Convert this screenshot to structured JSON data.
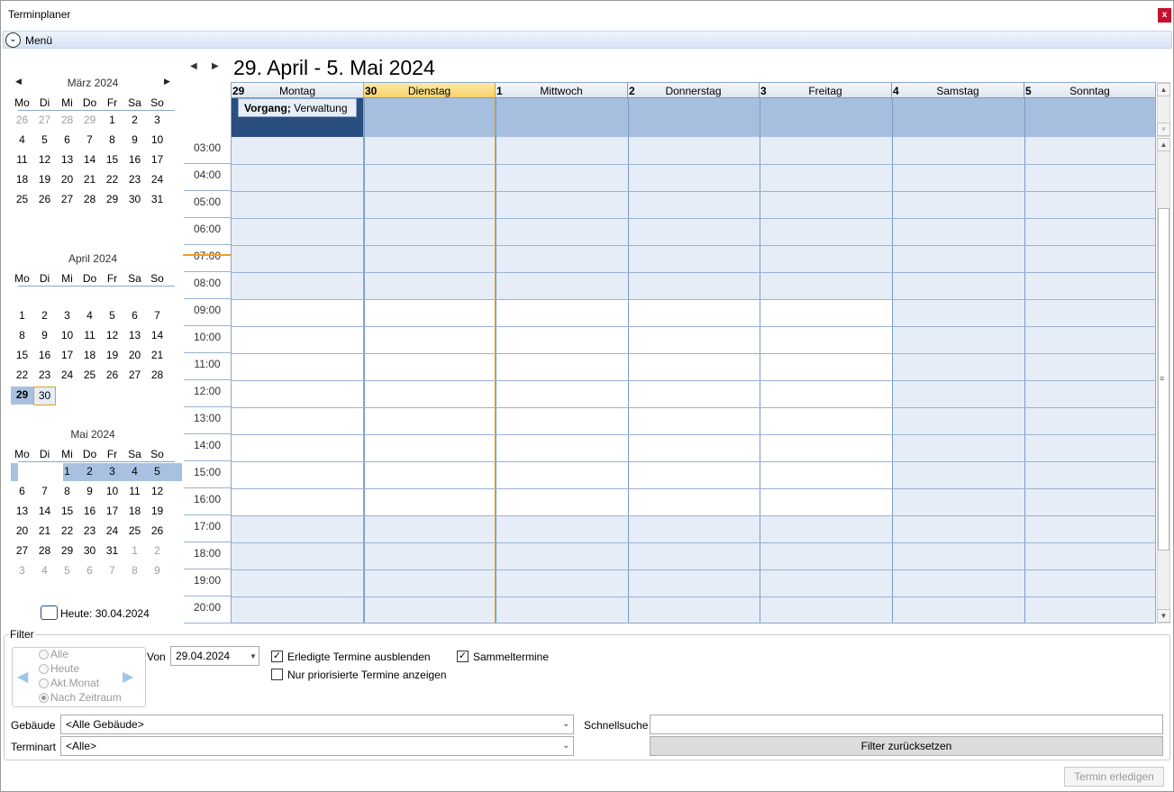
{
  "window": {
    "title": "Terminplaner",
    "close_label": "x"
  },
  "menu": {
    "label": "Menü",
    "icon": "chevron-down-icon"
  },
  "weekday_short": [
    "Mo",
    "Di",
    "Mi",
    "Do",
    "Fr",
    "Sa",
    "So"
  ],
  "mini_calendars": [
    {
      "title": "März 2024",
      "weeks": [
        [
          "26",
          "27",
          "28",
          "29",
          "1",
          "2",
          "3"
        ],
        [
          "4",
          "5",
          "6",
          "7",
          "8",
          "9",
          "10"
        ],
        [
          "11",
          "12",
          "13",
          "14",
          "15",
          "16",
          "17"
        ],
        [
          "18",
          "19",
          "20",
          "21",
          "22",
          "23",
          "24"
        ],
        [
          "25",
          "26",
          "27",
          "28",
          "29",
          "30",
          "31"
        ]
      ]
    },
    {
      "title": "April 2024",
      "weeks": [
        [
          "",
          "",
          "",
          "",
          "",
          "",
          ""
        ],
        [
          "1",
          "2",
          "3",
          "4",
          "5",
          "6",
          "7"
        ],
        [
          "8",
          "9",
          "10",
          "11",
          "12",
          "13",
          "14"
        ],
        [
          "15",
          "16",
          "17",
          "18",
          "19",
          "20",
          "21"
        ],
        [
          "22",
          "23",
          "24",
          "25",
          "26",
          "27",
          "28"
        ],
        [
          "29",
          "30",
          "",
          "",
          "",
          "",
          ""
        ]
      ]
    },
    {
      "title": "Mai 2024",
      "weeks": [
        [
          "",
          "",
          "1",
          "2",
          "3",
          "4",
          "5"
        ],
        [
          "6",
          "7",
          "8",
          "9",
          "10",
          "11",
          "12"
        ],
        [
          "13",
          "14",
          "15",
          "16",
          "17",
          "18",
          "19"
        ],
        [
          "20",
          "21",
          "22",
          "23",
          "24",
          "25",
          "26"
        ],
        [
          "27",
          "28",
          "29",
          "30",
          "31",
          "1",
          "2"
        ],
        [
          "3",
          "4",
          "5",
          "6",
          "7",
          "8",
          "9"
        ]
      ]
    }
  ],
  "today_label": "Heute: 30.04.2024",
  "scheduler": {
    "range_title": "29. April - 5. Mai 2024",
    "days": [
      {
        "num": "29",
        "name": "Montag"
      },
      {
        "num": "30",
        "name": "Dienstag"
      },
      {
        "num": "1",
        "name": "Mittwoch"
      },
      {
        "num": "2",
        "name": "Donnerstag"
      },
      {
        "num": "3",
        "name": "Freitag"
      },
      {
        "num": "4",
        "name": "Samstag"
      },
      {
        "num": "5",
        "name": "Sonntag"
      }
    ],
    "today_index": 1,
    "appointment": {
      "bold": "Vorgang;",
      "text": " Verwaltung"
    },
    "times": [
      "03:00",
      "04:00",
      "05:00",
      "06:00",
      "07:00",
      "08:00",
      "09:00",
      "10:00",
      "11:00",
      "12:00",
      "13:00",
      "14:00",
      "15:00",
      "16:00",
      "17:00",
      "18:00",
      "19:00",
      "20:00"
    ]
  },
  "filter": {
    "legend": "Filter",
    "period_options": [
      "Alle",
      "Heute",
      "Akt.Monat",
      "Nach Zeitraum"
    ],
    "period_selected": "Nach Zeitraum",
    "von_label": "Von",
    "von_value": "29.04.2024",
    "hide_done_label": "Erledigte Termine ausblenden",
    "hide_done_checked": true,
    "collective_label": "Sammeltermine",
    "collective_checked": true,
    "priority_label": "Nur priorisierte Termine anzeigen",
    "priority_checked": false,
    "building_label": "Gebäude",
    "building_value": "<Alle Gebäude>",
    "type_label": "Terminart",
    "type_value": "<Alle>",
    "quicksearch_label": "Schnellsuche",
    "quicksearch_value": "",
    "reset_label": "Filter zurücksetzen"
  },
  "done_button": "Termin erledigen"
}
